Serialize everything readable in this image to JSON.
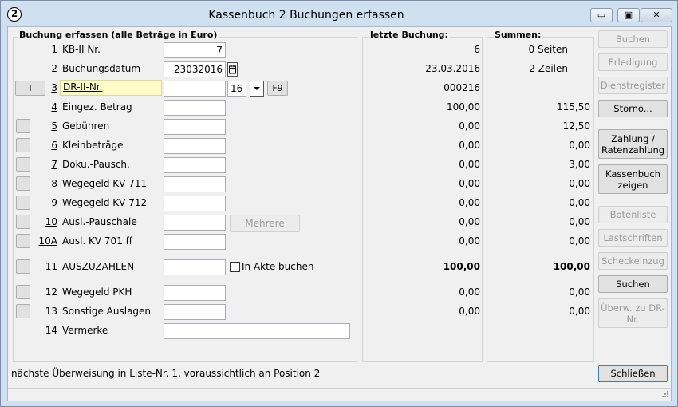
{
  "window": {
    "title": "Kassenbuch 2 Buchungen erfassen",
    "icon_text": "2"
  },
  "caption": {
    "minimize": "▭",
    "maximize": "▣",
    "close": "✕"
  },
  "form": {
    "header": "Buchung erfassen (alle Beträge in Euro)",
    "rows": [
      {
        "num": "1",
        "label": "KB-II Nr.",
        "value": "7"
      },
      {
        "num": "2",
        "label": "Buchungsdatum",
        "value": "23032016"
      },
      {
        "num": "3",
        "label": "DR-II-Nr.",
        "value": "",
        "suffix": "16"
      },
      {
        "num": "4",
        "label": "Eingez. Betrag",
        "value": ""
      },
      {
        "num": "5",
        "label": "Gebühren",
        "value": ""
      },
      {
        "num": "6",
        "label": "Kleinbeträge",
        "value": ""
      },
      {
        "num": "7",
        "label": "Doku.-Pausch.",
        "value": ""
      },
      {
        "num": "8",
        "label": "Wegegeld KV 711",
        "value": ""
      },
      {
        "num": "9",
        "label": "Wegegeld KV 712",
        "value": ""
      },
      {
        "num": "10",
        "label": "Ausl.-Pauschale",
        "value": ""
      },
      {
        "num": "10A",
        "label": "Ausl. KV 701 ff",
        "value": ""
      },
      {
        "num": "11",
        "label": "AUSZUZAHLEN",
        "value": ""
      },
      {
        "num": "12",
        "label": "Wegegeld PKH",
        "value": ""
      },
      {
        "num": "13",
        "label": "Sonstige Auslagen",
        "value": ""
      },
      {
        "num": "14",
        "label": "Vermerke",
        "value": ""
      }
    ],
    "row3_button": "I",
    "f9_button": "F9",
    "mehrere_button": "Mehrere",
    "akte_checkbox": "In Akte buchen"
  },
  "last": {
    "header": "letzte Buchung:",
    "values": [
      "6",
      "23.03.2016",
      "000216",
      "100,00",
      "0,00",
      "0,00",
      "0,00",
      "0,00",
      "0,00",
      "0,00",
      "0,00",
      "100,00",
      "0,00",
      "0,00"
    ]
  },
  "sums": {
    "header": "Summen:",
    "pages": "0 Seiten",
    "lines": "2 Zeilen",
    "values": [
      "115,50",
      "12,50",
      "0,00",
      "3,00",
      "0,00",
      "0,00",
      "0,00",
      "0,00",
      "100,00",
      "0,00",
      "0,00"
    ]
  },
  "buttons": {
    "buchen": "Buchen",
    "erledigung": "Erledigung",
    "dienstregister": "Dienstregister",
    "storno": "Storno...",
    "zahlung": "Zahlung / Ratenzahlung",
    "kassenbuch": "Kassenbuch zeigen",
    "botenliste": "Botenliste",
    "lastschriften": "Lastschriften",
    "scheckeinzug": "Scheckeinzug",
    "suchen": "Suchen",
    "ueberw": "Überw. zu DR-Nr.",
    "schliessen": "Schließen"
  },
  "status": "nächste Überweisung in Liste-Nr. 1, voraussichtlich an Position 2"
}
